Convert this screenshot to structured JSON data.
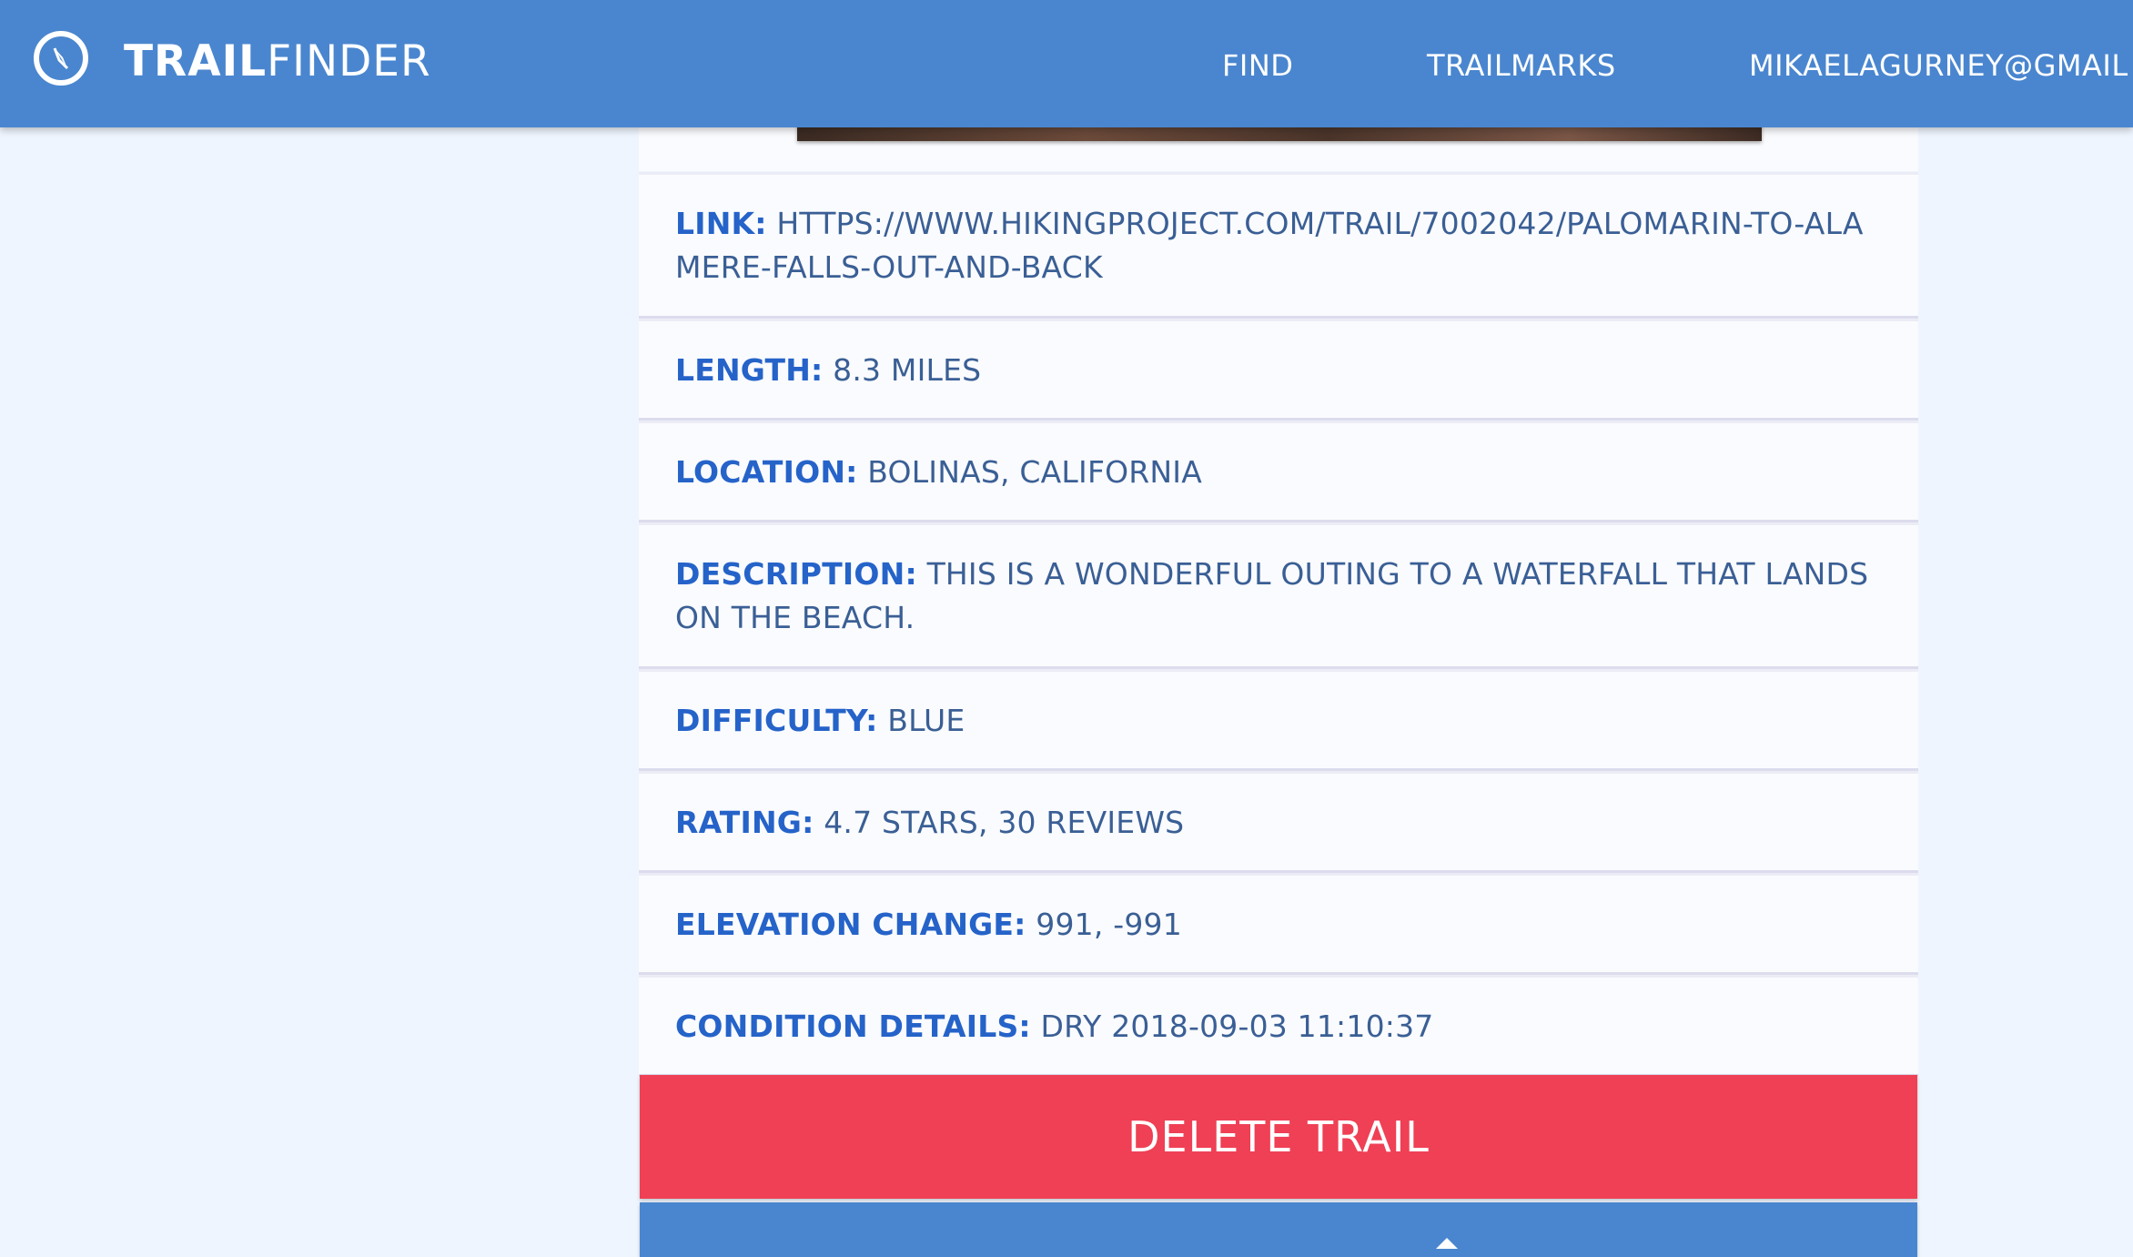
{
  "navbar": {
    "brand_bold": "TRAIL",
    "brand_light": "FINDER",
    "logo_icon": "compass-icon",
    "items": [
      {
        "label": "FIND"
      },
      {
        "label": "TRAILMARKS"
      },
      {
        "label": "MIKAELAGURNEY@GMAIL"
      }
    ]
  },
  "trail": {
    "link_label": "LINK:",
    "link_value": "HTTPS://WWW.HIKINGPROJECT.COM/TRAIL/7002042/PALOMARIN-TO-ALAMERE-FALLS-OUT-AND-BACK",
    "length_label": "LENGTH:",
    "length_value": "8.3 MILES",
    "location_label": "LOCATION:",
    "location_value": "BOLINAS, CALIFORNIA",
    "description_label": "DESCRIPTION:",
    "description_value": "THIS IS A WONDERFUL OUTING TO A WATERFALL THAT LANDS ON THE BEACH.",
    "difficulty_label": "DIFFICULTY:",
    "difficulty_value": "BLUE",
    "rating_label": "RATING:",
    "rating_value": "4.7 STARS, 30 REVIEWS",
    "elevation_label": "ELEVATION CHANGE:",
    "elevation_value": "991, -991",
    "condition_label": "CONDITION DETAILS:",
    "condition_value": "DRY 2018-09-03 11:10:37"
  },
  "actions": {
    "delete_label": "DELETE TRAIL",
    "collapse_icon": "chevron-up-icon"
  },
  "colors": {
    "navbar": "#4a86cf",
    "label": "#2563c9",
    "value": "#3a5f95",
    "delete": "#ef4055",
    "background": "#eff5fe"
  }
}
